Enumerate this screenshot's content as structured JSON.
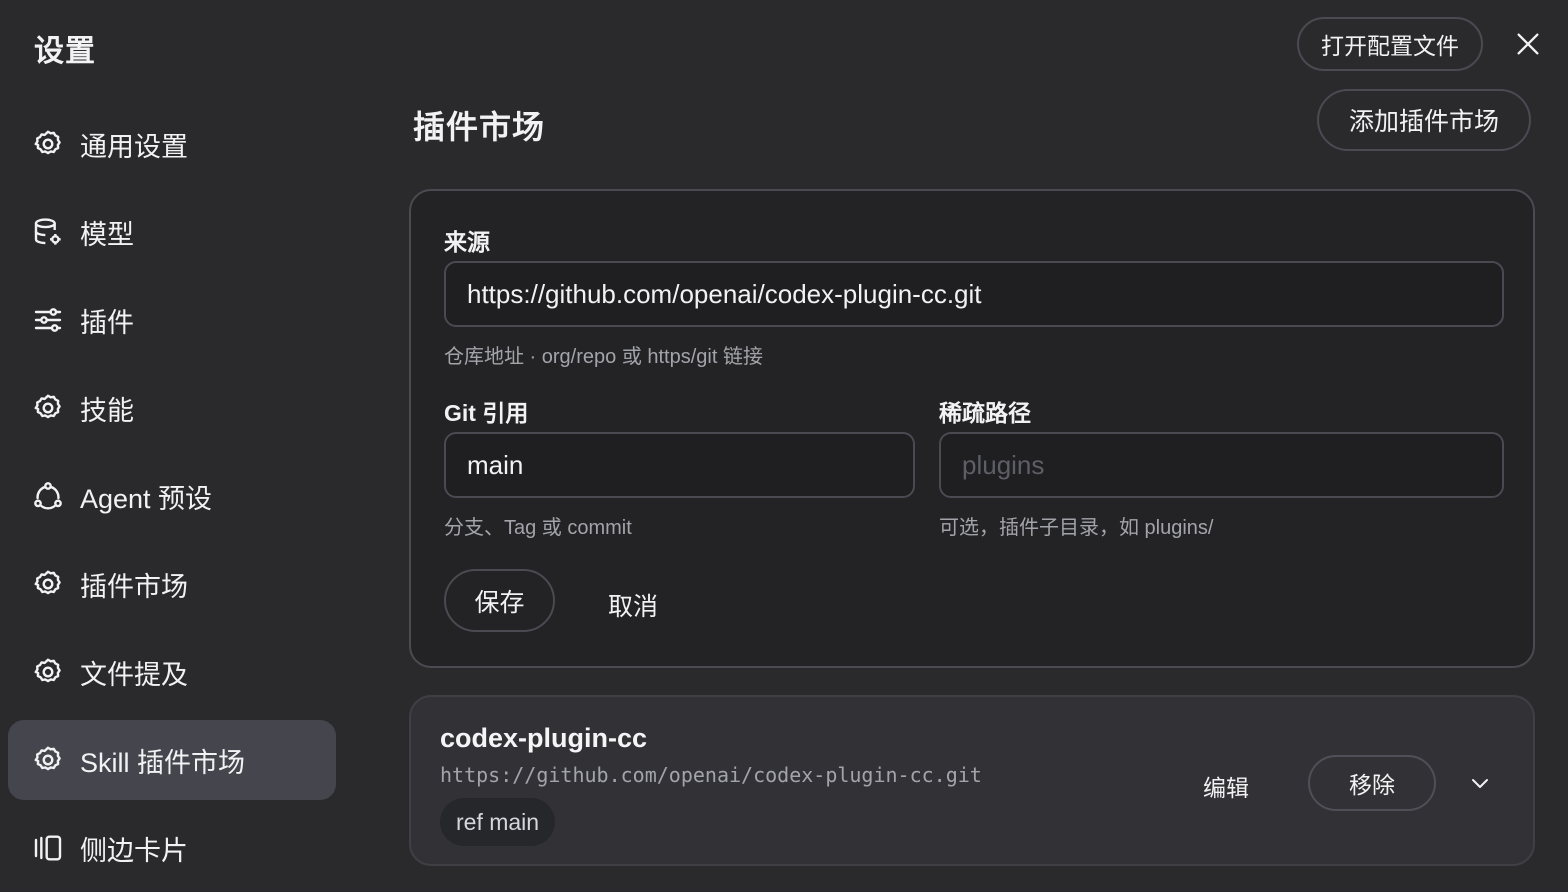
{
  "app": {
    "title": "设置"
  },
  "sidebar": {
    "items": [
      {
        "label": "通用设置",
        "icon": "gear-icon"
      },
      {
        "label": "模型",
        "icon": "database-gear-icon"
      },
      {
        "label": "插件",
        "icon": "sliders-icon"
      },
      {
        "label": "技能",
        "icon": "gear-icon"
      },
      {
        "label": "Agent 预设",
        "icon": "agent-nodes-icon"
      },
      {
        "label": "插件市场",
        "icon": "gear-icon"
      },
      {
        "label": "文件提及",
        "icon": "gear-icon"
      },
      {
        "label": "Skill 插件市场",
        "icon": "gear-icon",
        "active": true
      },
      {
        "label": "侧边卡片",
        "icon": "side-cards-icon"
      }
    ]
  },
  "header": {
    "open_config_label": "打开配置文件",
    "close_icon": "close-icon"
  },
  "main": {
    "title": "插件市场",
    "add_market_label": "添加插件市场",
    "form": {
      "source_label": "来源",
      "source_value": "https://github.com/openai/codex-plugin-cc.git",
      "source_hint": "仓库地址 · org/repo 或 https/git 链接",
      "git_ref_label": "Git 引用",
      "git_ref_value": "main",
      "git_ref_hint": "分支、Tag 或 commit",
      "sparse_path_label": "稀疏路径",
      "sparse_path_placeholder": "plugins",
      "sparse_path_hint": "可选，插件子目录，如 plugins/",
      "save_label": "保存",
      "cancel_label": "取消"
    },
    "market": {
      "name": "codex-plugin-cc",
      "url": "https://github.com/openai/codex-plugin-cc.git",
      "ref_badge": "ref main",
      "edit_label": "编辑",
      "remove_label": "移除",
      "expand_icon": "chevron-down-icon"
    }
  },
  "colors": {
    "background": "#2a2a2d",
    "card": "#232325",
    "active_nav": "#45464d",
    "border": "#4a4b52",
    "text": "#f2f2f4",
    "muted": "#a3a4ab"
  }
}
